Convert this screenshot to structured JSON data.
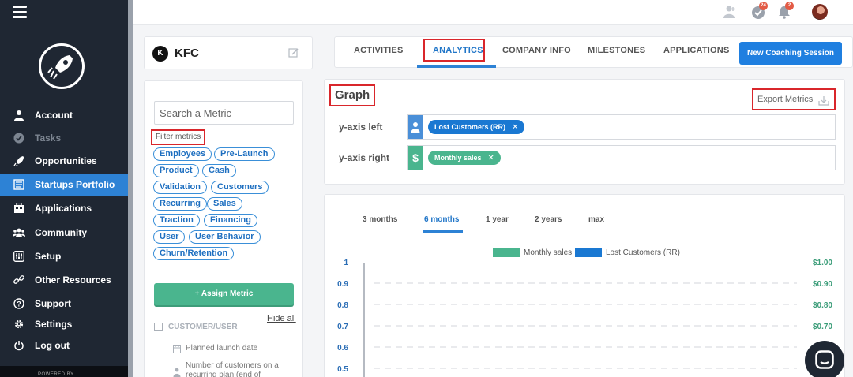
{
  "app": {
    "powered_by": "POWERED BY"
  },
  "sidebar": {
    "items": [
      {
        "label": "Account",
        "icon": "user-icon"
      },
      {
        "label": "Tasks",
        "icon": "check-circle-icon"
      },
      {
        "label": "Opportunities",
        "icon": "rocket-icon"
      },
      {
        "label": "Startups Portfolio",
        "icon": "portfolio-icon"
      },
      {
        "label": "Applications",
        "icon": "applications-icon"
      },
      {
        "label": "Community",
        "icon": "community-icon"
      },
      {
        "label": "Setup",
        "icon": "setup-sliders-icon"
      },
      {
        "label": "Other Resources",
        "icon": "link-icon"
      },
      {
        "label": "Support",
        "icon": "question-icon"
      },
      {
        "label": "Settings",
        "icon": "gear-icon"
      },
      {
        "label": "Log out",
        "icon": "power-icon"
      }
    ],
    "active_index": 3
  },
  "topbar": {
    "tasks_badge": "24",
    "notifications_badge": "2"
  },
  "company": {
    "initial": "K",
    "name": "KFC"
  },
  "metrics_panel": {
    "search_placeholder": "Search a Metric",
    "filter_label": "Filter metrics",
    "tags": [
      "Employees",
      "Pre-Launch",
      "Product",
      "Cash",
      "Validation",
      "Customers",
      "Recurring",
      "Sales",
      "Traction",
      "Financing",
      "User",
      "User Behavior",
      "Churn/Retention"
    ],
    "assign_button": "+ Assign Metric",
    "hide_all": "Hide all",
    "category": "CUSTOMER/USER",
    "metrics": [
      "Planned launch date",
      "Number of customers on a recurring plan (end of"
    ]
  },
  "tabs": {
    "items": [
      "ACTIVITIES",
      "ANALYTICS",
      "COMPANY INFO",
      "MILESTONES",
      "APPLICATIONS"
    ],
    "active": "ANALYTICS",
    "new_session_button": "New Coaching Session"
  },
  "graph": {
    "title": "Graph",
    "export_label": "Export Metrics",
    "y_left_label": "y-axis left",
    "y_right_label": "y-axis right",
    "y_left_chip": "Lost Customers (RR)",
    "y_right_chip": "Monthly sales",
    "y_left_color": "#1a78d2",
    "y_right_color": "#4ab58e",
    "y_left_icon": "person-icon",
    "y_right_icon": "dollar-icon",
    "y_right_symbol": "$"
  },
  "chart": {
    "ranges": [
      "3 months",
      "6 months",
      "1 year",
      "2 years",
      "max"
    ],
    "active_range": "6 months"
  },
  "chart_data": {
    "type": "line",
    "series": [
      {
        "name": "Monthly sales",
        "color": "#4ab58e",
        "values": []
      },
      {
        "name": "Lost Customers (RR)",
        "color": "#1a78d2",
        "values": []
      }
    ],
    "y_left_ticks": [
      "1",
      "0.9",
      "0.8",
      "0.7",
      "0.6",
      "0.5"
    ],
    "y_right_ticks": [
      "$1.00",
      "$0.90",
      "$0.80",
      "$0.70",
      "$0.60",
      "$0.50"
    ],
    "ylim": [
      0.5,
      1
    ],
    "grid": true
  }
}
